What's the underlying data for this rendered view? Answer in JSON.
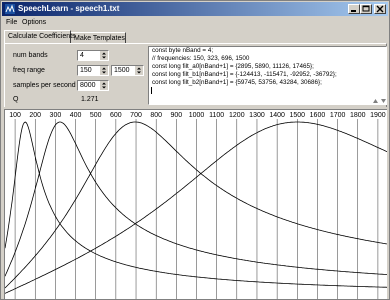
{
  "window": {
    "title": "SpeechLearn - speech1.txt"
  },
  "menu": {
    "file": "File",
    "options": "Options"
  },
  "tabs": {
    "calc": "Calculate Coefficients",
    "templates": "Make Templates"
  },
  "form": {
    "num_bands_label": "num bands",
    "num_bands": "4",
    "freq_range_label": "freq range",
    "freq_low": "150",
    "freq_high": "1500",
    "sps_label": "samples per second",
    "sps": "8000",
    "q_label": "Q",
    "q_value": "1.271"
  },
  "code": [
    "const byte nBand = 4;",
    "// frequencies: 150, 323, 696, 1500",
    "const long filt_a0[nBand+1] = {2895, 5890, 11126, 17465};",
    "const long filt_b1[nBand+1] = {-124413, -115471, -92952, -36792};",
    "const long filt_b2[nBand+1] = {59745, 53756, 43284, 30686};"
  ],
  "chart_data": {
    "type": "line",
    "x_ticks": [
      "100",
      "200",
      "300",
      "400",
      "500",
      "600",
      "700",
      "800",
      "900",
      "1000",
      "1100",
      "1200",
      "1300",
      "1400",
      "1500",
      "1600",
      "1700",
      "1800",
      "1900"
    ],
    "xlim": [
      50,
      1950
    ],
    "ylim": [
      0,
      1
    ],
    "grid": true,
    "center_frequencies": [
      150,
      323,
      696,
      1500
    ],
    "q": 1.271,
    "series": [
      {
        "peak_x": 150
      },
      {
        "peak_x": 323
      },
      {
        "peak_x": 696
      },
      {
        "peak_x": 1500
      }
    ]
  }
}
